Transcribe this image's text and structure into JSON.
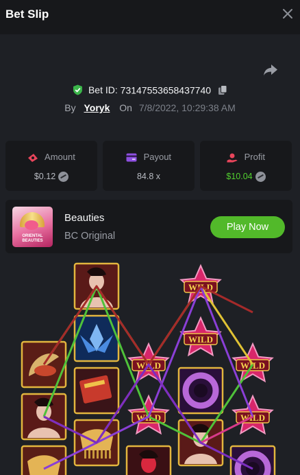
{
  "header": {
    "title": "Bet Slip",
    "close_icon": "close-icon"
  },
  "bet": {
    "id_label": "Bet ID:",
    "id_value": "73147553658437740",
    "by_label": "By",
    "user": "Yoryk",
    "on_label": "On",
    "date": "7/8/2022, 10:29:38 AM"
  },
  "stats": {
    "amount": {
      "label": "Amount",
      "value": "$0.12",
      "icon": "cash-icon"
    },
    "payout": {
      "label": "Payout",
      "value": "84.8 x",
      "icon": "card-icon"
    },
    "profit": {
      "label": "Profit",
      "value": "$10.04",
      "icon": "hand-money-icon"
    }
  },
  "game": {
    "name": "Beauties",
    "provider": "BC Original",
    "thumb_caption": "ORIENTAL BEAUTIES",
    "play_label": "Play Now"
  },
  "board": {
    "wild_label": "WILD",
    "symbols": [
      {
        "col": 0,
        "row": 1,
        "kind": "koi"
      },
      {
        "col": 0,
        "row": 2,
        "kind": "lady"
      },
      {
        "col": 0,
        "row": 3,
        "kind": "comb"
      },
      {
        "col": 1,
        "row": 0,
        "kind": "lady"
      },
      {
        "col": 1,
        "row": 1,
        "kind": "lotus"
      },
      {
        "col": 1,
        "row": 2,
        "kind": "book"
      },
      {
        "col": 1,
        "row": 3,
        "kind": "comb"
      },
      {
        "col": 2,
        "row": 1,
        "kind": "wild"
      },
      {
        "col": 2,
        "row": 2,
        "kind": "wild"
      },
      {
        "col": 2,
        "row": 3,
        "kind": "geisha"
      },
      {
        "col": 3,
        "row": 0,
        "kind": "wild"
      },
      {
        "col": 3,
        "row": 1,
        "kind": "wild"
      },
      {
        "col": 3,
        "row": 2,
        "kind": "bracelet"
      },
      {
        "col": 3,
        "row": 3,
        "kind": "lady"
      },
      {
        "col": 4,
        "row": 1,
        "kind": "wild"
      },
      {
        "col": 4,
        "row": 2,
        "kind": "wild"
      },
      {
        "col": 4,
        "row": 3,
        "kind": "bracelet"
      }
    ],
    "paylines": [
      {
        "color": "#e0c234",
        "rows": [
          1,
          0,
          1,
          0,
          1
        ]
      },
      {
        "color": "#4fc23a",
        "rows": [
          2,
          0,
          2,
          3,
          1
        ]
      },
      {
        "color": "#8a3fd6",
        "rows": [
          3,
          3,
          2,
          0,
          2
        ]
      },
      {
        "color": "#d83a8a",
        "rows": [
          2,
          3,
          1,
          3,
          2
        ]
      },
      {
        "color": "#a52a2a",
        "rows": [
          1,
          0,
          1,
          0,
          0
        ]
      },
      {
        "color": "#7b2fc0",
        "rows": [
          2,
          3,
          1,
          3,
          3
        ]
      }
    ]
  }
}
